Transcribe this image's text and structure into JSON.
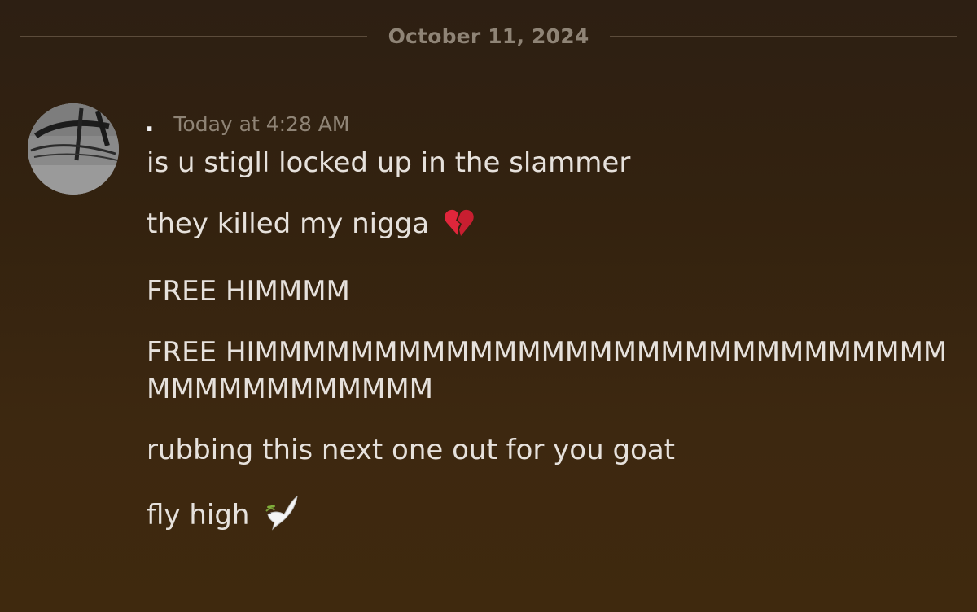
{
  "chat": {
    "date_divider": "October 11, 2024",
    "author": {
      "name": ".",
      "timestamp": "Today at 4:28 AM",
      "avatar_icon": "avatar-image"
    },
    "messages": [
      {
        "text": "is u stigll locked up in the slammer"
      },
      {
        "text": "they killed my nigga",
        "emoji": "broken-heart-icon"
      },
      {
        "text": "FREE HIMMMM"
      },
      {
        "text": "FREE HIMMMMMMMMMMMMMMMMMMMMMMMMMMMMMMMMMMMMMMMMM"
      },
      {
        "text": "rubbing this next one out for you goat"
      },
      {
        "text": "fly high",
        "emoji": "dove-icon"
      }
    ]
  }
}
